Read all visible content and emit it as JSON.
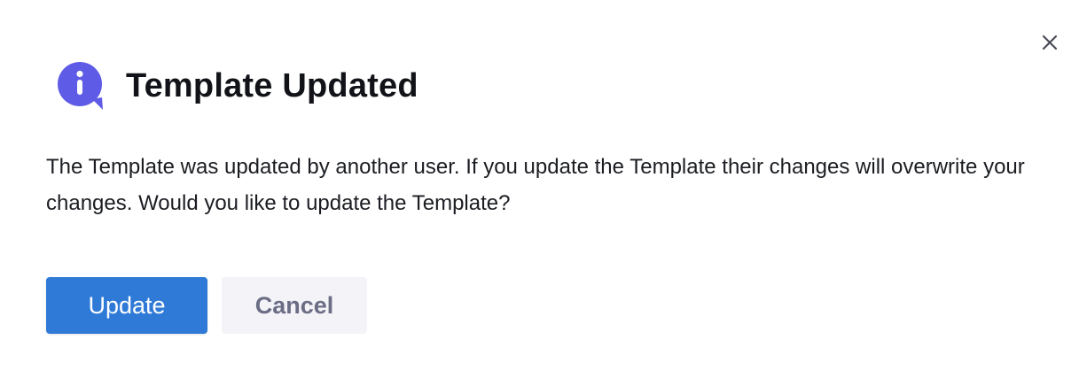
{
  "dialog": {
    "title": "Template Updated",
    "message": "The Template was updated by another user. If you update the Template their changes will overwrite your changes. Would you like to update the Template?",
    "icon": "info-icon",
    "close_icon": "close-icon",
    "buttons": {
      "primary_label": "Update",
      "secondary_label": "Cancel"
    }
  },
  "colors": {
    "accent": "#2f7ad6",
    "info_icon": "#5e5be6",
    "title_text": "#111318",
    "secondary_button_bg": "#f3f3f8",
    "secondary_button_text": "#6b6d85"
  }
}
